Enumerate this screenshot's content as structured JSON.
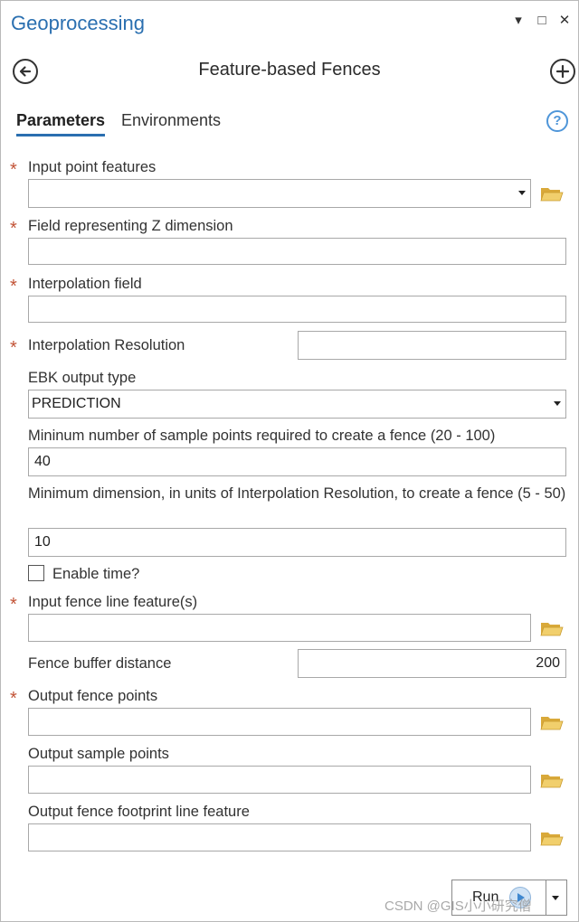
{
  "window": {
    "title": "Geoprocessing",
    "controls": {
      "menu_icon": "▾",
      "maximize_icon": "□",
      "close_icon": "✕"
    }
  },
  "tool": {
    "name": "Feature-based Fences",
    "back_icon": "back-arrow-icon",
    "add_icon": "plus-icon"
  },
  "tabs": [
    {
      "label": "Parameters",
      "active": true
    },
    {
      "label": "Environments",
      "active": false
    }
  ],
  "help": {
    "glyph": "?"
  },
  "required_marker": "*",
  "params": {
    "input_point_features": {
      "label": "Input point features",
      "required": true,
      "value": ""
    },
    "z_field": {
      "label": "Field representing Z dimension",
      "required": true,
      "value": ""
    },
    "interp_field": {
      "label": "Interpolation field",
      "required": true,
      "value": ""
    },
    "interp_resolution": {
      "label": "Interpolation Resolution",
      "required": true,
      "value": ""
    },
    "ebk_output_type": {
      "label": "EBK output type",
      "required": false,
      "value": "PREDICTION"
    },
    "min_sample_points": {
      "label": "Mininum number of sample points required to create a fence (20 - 100)",
      "required": false,
      "value": "40"
    },
    "min_dimension": {
      "label": "Minimum dimension, in units of Interpolation Resolution, to create a fence (5 - 50)",
      "required": false,
      "value": "10"
    },
    "enable_time": {
      "label": "Enable time?",
      "checked": false
    },
    "fence_line_features": {
      "label": "Input fence line feature(s)",
      "required": true,
      "value": ""
    },
    "fence_buffer_distance": {
      "label": "Fence buffer distance",
      "required": false,
      "value": "200"
    },
    "output_fence_points": {
      "label": "Output fence points",
      "required": true,
      "value": ""
    },
    "output_sample_points": {
      "label": "Output sample points",
      "required": false,
      "value": ""
    },
    "output_footprint": {
      "label": "Output fence footprint line feature",
      "required": false,
      "value": ""
    }
  },
  "run": {
    "label": "Run"
  },
  "watermark": "CSDN @GIS小小研究僧",
  "colors": {
    "accent": "#2a6fb0",
    "required": "#c25336",
    "folder": "#e2b84a",
    "help": "#4f96d9"
  }
}
